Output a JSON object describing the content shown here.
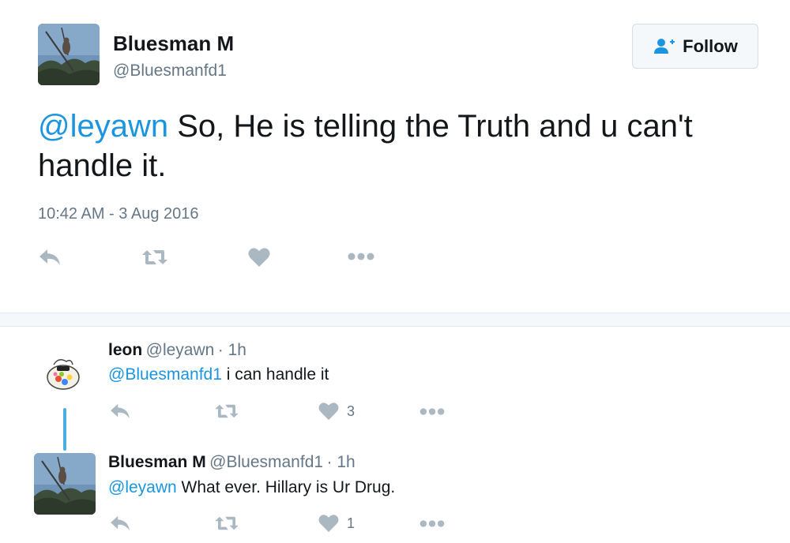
{
  "tweet": {
    "author_name": "Bluesman M",
    "author_handle": "@Bluesmanfd1",
    "follow_label": "Follow",
    "mention": "@leyawn",
    "body": " So, He is telling the Truth and u can't handle it.",
    "timestamp": "10:42 AM - 3 Aug 2016",
    "actions": [
      "reply-icon",
      "retweet-icon",
      "like-icon",
      "more-icon"
    ]
  },
  "replies": [
    {
      "name": "leon",
      "handle": "@leyawn",
      "time": "· 1h",
      "mention": "@Bluesmanfd1",
      "text": " i can handle it",
      "like_count": "3"
    },
    {
      "name": "Bluesman M",
      "handle": "@Bluesmanfd1",
      "time": "· 1h",
      "mention": "@leyawn",
      "text": " What ever. Hillary is Ur Drug.",
      "like_count": "1"
    }
  ],
  "colors": {
    "link": "#1b95e0",
    "text": "#14171a",
    "muted": "#657786",
    "icon": "#aab8c2",
    "thread": "#4aaee0"
  }
}
